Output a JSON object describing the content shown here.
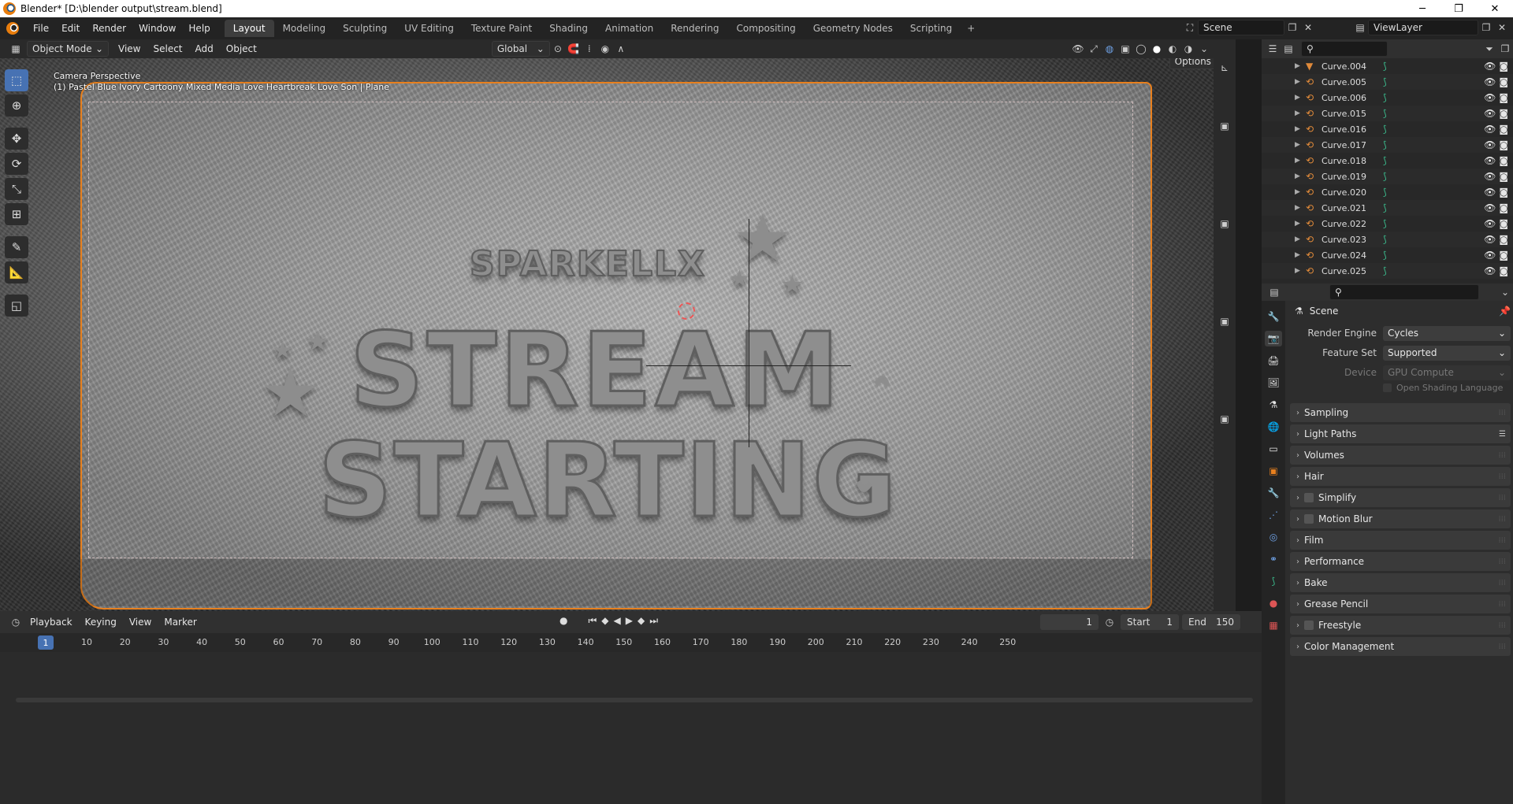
{
  "window": {
    "title": "Blender* [D:\\blender output\\stream.blend]",
    "minimize": "─",
    "maximize": "❐",
    "close": "✕"
  },
  "menu": [
    "File",
    "Edit",
    "Render",
    "Window",
    "Help"
  ],
  "workspaces": [
    "Layout",
    "Modeling",
    "Sculpting",
    "UV Editing",
    "Texture Paint",
    "Shading",
    "Animation",
    "Rendering",
    "Compositing",
    "Geometry Nodes",
    "Scripting"
  ],
  "workspace_add": "+",
  "scene": {
    "name": "Scene",
    "view_layer": "ViewLayer"
  },
  "viewport_header": {
    "mode": "Object Mode",
    "menus": [
      "View",
      "Select",
      "Add",
      "Object"
    ],
    "orientation": "Global",
    "options": "Options"
  },
  "viewport": {
    "perspective": "Camera Perspective",
    "object_info": "(1) Pastel Blue Ivory Cartoony Mixed Media Love Heartbreak Love Son | Plane"
  },
  "outliner": {
    "rows": [
      "Curve.004",
      "Curve.005",
      "Curve.006",
      "Curve.015",
      "Curve.016",
      "Curve.017",
      "Curve.018",
      "Curve.019",
      "Curve.020",
      "Curve.021",
      "Curve.022",
      "Curve.023",
      "Curve.024",
      "Curve.025"
    ]
  },
  "properties": {
    "context": "Scene",
    "render_engine_label": "Render Engine",
    "render_engine": "Cycles",
    "feature_set_label": "Feature Set",
    "feature_set": "Supported",
    "device_label": "Device",
    "device": "GPU Compute",
    "osl": "Open Shading Language",
    "panels": [
      {
        "label": "Sampling",
        "check": false
      },
      {
        "label": "Light Paths",
        "check": false
      },
      {
        "label": "Volumes",
        "check": false
      },
      {
        "label": "Hair",
        "check": false
      },
      {
        "label": "Simplify",
        "check": true
      },
      {
        "label": "Motion Blur",
        "check": true
      },
      {
        "label": "Film",
        "check": false
      },
      {
        "label": "Performance",
        "check": false
      },
      {
        "label": "Bake",
        "check": false
      },
      {
        "label": "Grease Pencil",
        "check": false
      },
      {
        "label": "Freestyle",
        "check": true
      },
      {
        "label": "Color Management",
        "check": false
      }
    ]
  },
  "timeline": {
    "menus": [
      "Playback",
      "Keying",
      "View",
      "Marker"
    ],
    "current_frame": "1",
    "start_label": "Start",
    "start": "1",
    "end_label": "End",
    "end": "150",
    "ticks": [
      "1",
      "10",
      "20",
      "30",
      "40",
      "50",
      "60",
      "70",
      "80",
      "90",
      "100",
      "110",
      "120",
      "130",
      "140",
      "150",
      "160",
      "170",
      "180",
      "190",
      "200",
      "210",
      "220",
      "230",
      "240",
      "250"
    ]
  },
  "artwork": {
    "line1": "SPARKELLX",
    "line2": "STREAM",
    "line3": "STARTING"
  }
}
